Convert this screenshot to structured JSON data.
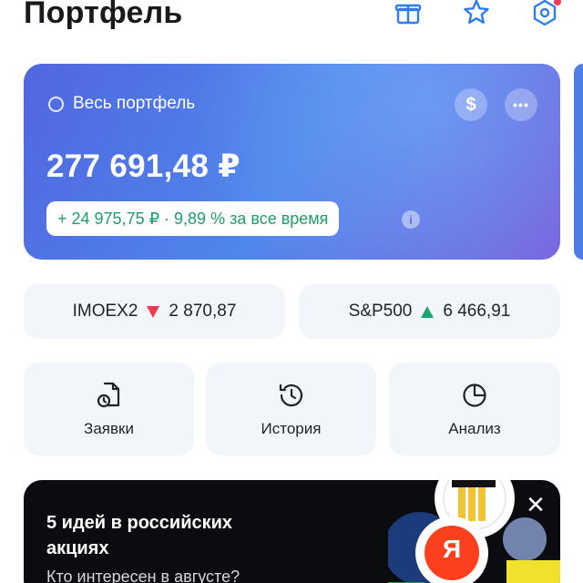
{
  "header": {
    "title": "Портфель",
    "icons": [
      "gift-icon",
      "star-icon",
      "settings-gear-icon"
    ]
  },
  "portfolio": {
    "label": "Весь портфель",
    "value": "277 691,48 ₽",
    "gain": "+ 24 975,75 ₽ · 9,89 % за все время",
    "currency_button": "$",
    "more_button": "•••",
    "info_icon": "i"
  },
  "indices": [
    {
      "name": "IMOEX2",
      "direction": "down",
      "value": "2 870,87"
    },
    {
      "name": "S&P500",
      "direction": "up",
      "value": "6 466,91"
    }
  ],
  "actions": [
    {
      "label": "Заявки",
      "icon": "order-document-clock-icon"
    },
    {
      "label": "История",
      "icon": "history-clock-icon"
    },
    {
      "label": "Анализ",
      "icon": "pie-chart-icon"
    }
  ],
  "promo": {
    "title": "5 идей в российских акциях",
    "subtitle": "Кто интересен в августе?",
    "logo_letter": "Я",
    "close": "✕"
  },
  "colors": {
    "accent_gradient_start": "#5166e0",
    "accent_gradient_end": "#7a5fdc",
    "gain_green": "#1e9e6a",
    "down_red": "#ee3b4f",
    "up_green": "#1fa371",
    "tile_bg": "#f2f5fa"
  }
}
